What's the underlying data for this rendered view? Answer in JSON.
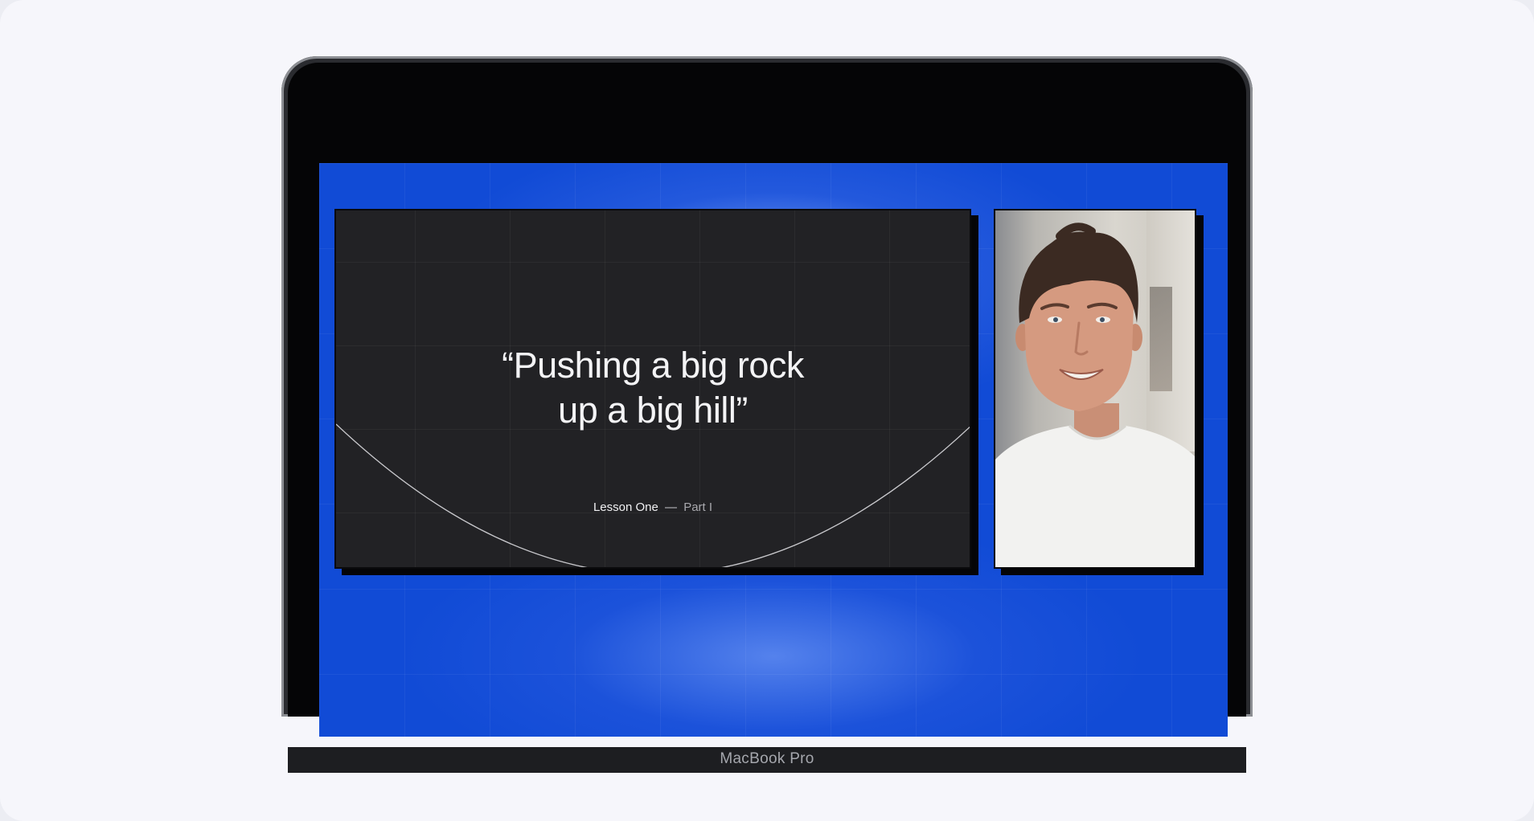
{
  "device": {
    "label": "MacBook Pro"
  },
  "slide": {
    "quote": "“Pushing a big rock\nup a big hill”",
    "lesson": "Lesson One",
    "separator": "—",
    "part": "Part I"
  },
  "video": {
    "icon": "presenter-video-feed"
  },
  "colors": {
    "screen_background": "#114bd6",
    "slide_background": "#222225",
    "page_background": "#f6f6fb"
  }
}
